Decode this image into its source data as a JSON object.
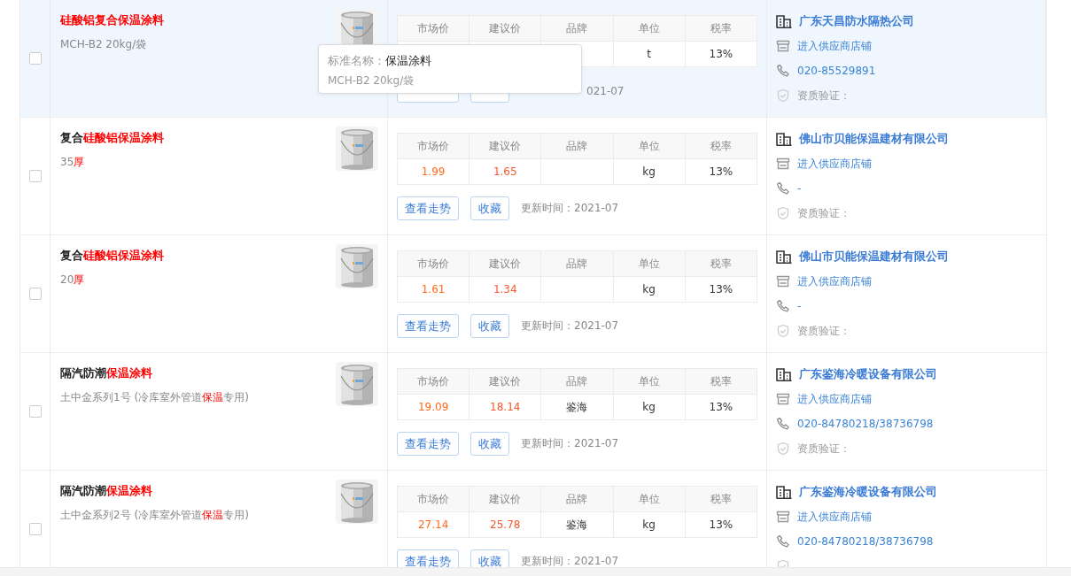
{
  "rows": [
    {
      "hovered": true,
      "checked": false,
      "title": [
        {
          "text": "硅酸铝复合保温涂料",
          "highlight": true
        }
      ],
      "spec": [
        {
          "text": "MCH-B2 20kg/袋",
          "highlight": false
        }
      ],
      "columns": [
        "市场价",
        "建议价",
        "品牌",
        "单位",
        "税率"
      ],
      "prices": {
        "unit": "t",
        "tax": "13%"
      },
      "actions": [
        {
          "kind": "trend"
        },
        {
          "kind": "favorite"
        }
      ],
      "updated": "021-07",
      "tooltip": {
        "label": "标准名称：",
        "value": "保温涂料",
        "spec": "MCH-B2 20kg/袋"
      },
      "supplier": {
        "name": "广东天昌防水隔热公司",
        "shop": "进入供应商店铺",
        "phone": "020-85529891",
        "qualification": "资质验证："
      }
    },
    {
      "hovered": false,
      "checked": false,
      "title": [
        {
          "text": "复合",
          "highlight": false
        },
        {
          "text": "硅酸铝保温涂料",
          "highlight": true
        }
      ],
      "spec": [
        {
          "text": "35",
          "highlight": false
        },
        {
          "text": "厚",
          "highlight": true
        }
      ],
      "columns": [
        "市场价",
        "建议价",
        "品牌",
        "单位",
        "税率"
      ],
      "prices": {
        "market": "1.99",
        "suggested": "1.65",
        "unit": "kg",
        "tax": "13%"
      },
      "actions": [
        {
          "kind": "trend",
          "label": "查看走势"
        },
        {
          "kind": "favorite",
          "label": "收藏"
        }
      ],
      "updated": "更新时间：2021-07",
      "supplier": {
        "name": "佛山市贝能保温建材有限公司",
        "shop": "进入供应商店铺",
        "phone": "-",
        "qualification": "资质验证："
      }
    },
    {
      "hovered": false,
      "checked": false,
      "title": [
        {
          "text": "复合",
          "highlight": false
        },
        {
          "text": "硅酸铝保温涂料",
          "highlight": true
        }
      ],
      "spec": [
        {
          "text": "20",
          "highlight": false
        },
        {
          "text": "厚",
          "highlight": true
        }
      ],
      "columns": [
        "市场价",
        "建议价",
        "品牌",
        "单位",
        "税率"
      ],
      "prices": {
        "market": "1.61",
        "suggested": "1.34",
        "unit": "kg",
        "tax": "13%"
      },
      "actions": [
        {
          "kind": "trend",
          "label": "查看走势"
        },
        {
          "kind": "favorite",
          "label": "收藏"
        }
      ],
      "updated": "更新时间：2021-07",
      "supplier": {
        "name": "佛山市贝能保温建材有限公司",
        "shop": "进入供应商店铺",
        "phone": "-",
        "qualification": "资质验证："
      }
    },
    {
      "hovered": false,
      "checked": false,
      "title": [
        {
          "text": "隔汽防潮",
          "highlight": false
        },
        {
          "text": "保温涂料",
          "highlight": true
        }
      ],
      "spec": [
        {
          "text": "土中金系列1号 (冷库室外管道",
          "highlight": false
        },
        {
          "text": "保温",
          "highlight": true
        },
        {
          "text": "专用)",
          "highlight": false
        }
      ],
      "columns": [
        "市场价",
        "建议价",
        "品牌",
        "单位",
        "税率"
      ],
      "prices": {
        "market": "19.09",
        "suggested": "18.14",
        "brand": "鉴海",
        "unit": "kg",
        "tax": "13%"
      },
      "actions": [
        {
          "kind": "trend",
          "label": "查看走势"
        },
        {
          "kind": "favorite",
          "label": "收藏"
        }
      ],
      "updated": "更新时间：2021-07",
      "supplier": {
        "name": "广东鉴海冷暖设备有限公司",
        "shop": "进入供应商店铺",
        "phone": "020-84780218/38736798",
        "qualification": "资质验证："
      }
    },
    {
      "hovered": false,
      "checked": false,
      "title": [
        {
          "text": "隔汽防潮",
          "highlight": false
        },
        {
          "text": "保温涂料",
          "highlight": true
        }
      ],
      "spec": [
        {
          "text": "土中金系列2号 (冷库室外管道",
          "highlight": false
        },
        {
          "text": "保温",
          "highlight": true
        },
        {
          "text": "专用)",
          "highlight": false
        }
      ],
      "columns": [
        "市场价",
        "建议价",
        "品牌",
        "单位",
        "税率"
      ],
      "prices": {
        "market": "27.14",
        "suggested": "25.78",
        "brand": "鉴海",
        "unit": "kg",
        "tax": "13%"
      },
      "actions": [
        {
          "kind": "trend",
          "label": "查看走势"
        },
        {
          "kind": "favorite",
          "label": "收藏"
        }
      ],
      "updated": "更新时间：2021-07",
      "supplier": {
        "name": "广东鉴海冷暖设备有限公司",
        "shop": "进入供应商店铺",
        "phone": "020-84780218/38736798"
      }
    }
  ]
}
